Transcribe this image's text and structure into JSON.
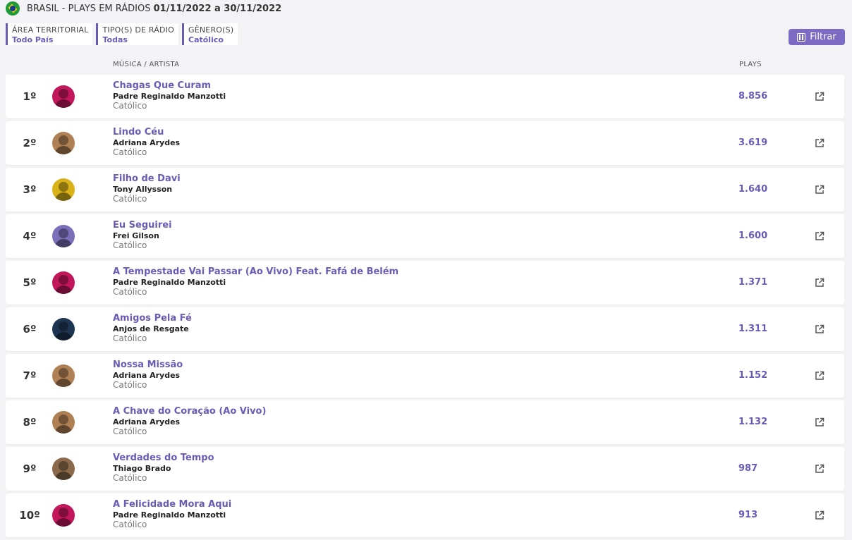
{
  "header": {
    "title": "BRASIL - PLAYS EM RÁDIOS",
    "dates": "01/11/2022 a 30/11/2022"
  },
  "filters": [
    {
      "label": "ÁREA TERRITORIAL",
      "value": "Todo País"
    },
    {
      "label": "TIPO(S) DE RÁDIO",
      "value": "Todas"
    },
    {
      "label": "GÊNERO(S)",
      "value": "Católico"
    }
  ],
  "filter_button": {
    "label": "Filtrar",
    "icon": "sliders-icon"
  },
  "columns": {
    "song_artist": "MÚSICA / ARTISTA",
    "plays": "PLAYS"
  },
  "accent_color": "#6b5bb5",
  "rows": [
    {
      "rank": "1º",
      "song": "Chagas Que Curam",
      "artist": "Padre Reginaldo Manzotti",
      "genre": "Católico",
      "plays": "8.856",
      "avatar_color": "#c2185b"
    },
    {
      "rank": "2º",
      "song": "Lindo Céu",
      "artist": "Adriana Arydes",
      "genre": "Católico",
      "plays": "3.619",
      "avatar_color": "#b08055"
    },
    {
      "rank": "3º",
      "song": "Filho de Davi",
      "artist": "Tony Allysson",
      "genre": "Católico",
      "plays": "1.640",
      "avatar_color": "#d9b21a"
    },
    {
      "rank": "4º",
      "song": "Eu Seguirei",
      "artist": "Frei Gilson",
      "genre": "Católico",
      "plays": "1.600",
      "avatar_color": "#7a6fb8"
    },
    {
      "rank": "5º",
      "song": "A Tempestade Vai Passar (Ao Vivo) Feat. Fafá de Belém",
      "artist": "Padre Reginaldo Manzotti",
      "genre": "Católico",
      "plays": "1.371",
      "avatar_color": "#c2185b"
    },
    {
      "rank": "6º",
      "song": "Amigos Pela Fé",
      "artist": "Anjos de Resgate",
      "genre": "Católico",
      "plays": "1.311",
      "avatar_color": "#1e3552"
    },
    {
      "rank": "7º",
      "song": "Nossa Missão",
      "artist": "Adriana Arydes",
      "genre": "Católico",
      "plays": "1.152",
      "avatar_color": "#b08055"
    },
    {
      "rank": "8º",
      "song": "A Chave do Coração (Ao Vivo)",
      "artist": "Adriana Arydes",
      "genre": "Católico",
      "plays": "1.132",
      "avatar_color": "#b08055"
    },
    {
      "rank": "9º",
      "song": "Verdades do Tempo",
      "artist": "Thiago Brado",
      "genre": "Católico",
      "plays": "987",
      "avatar_color": "#8a6a4a"
    },
    {
      "rank": "10º",
      "song": "A Felicidade Mora Aqui",
      "artist": "Padre Reginaldo Manzotti",
      "genre": "Católico",
      "plays": "913",
      "avatar_color": "#c2185b"
    }
  ]
}
